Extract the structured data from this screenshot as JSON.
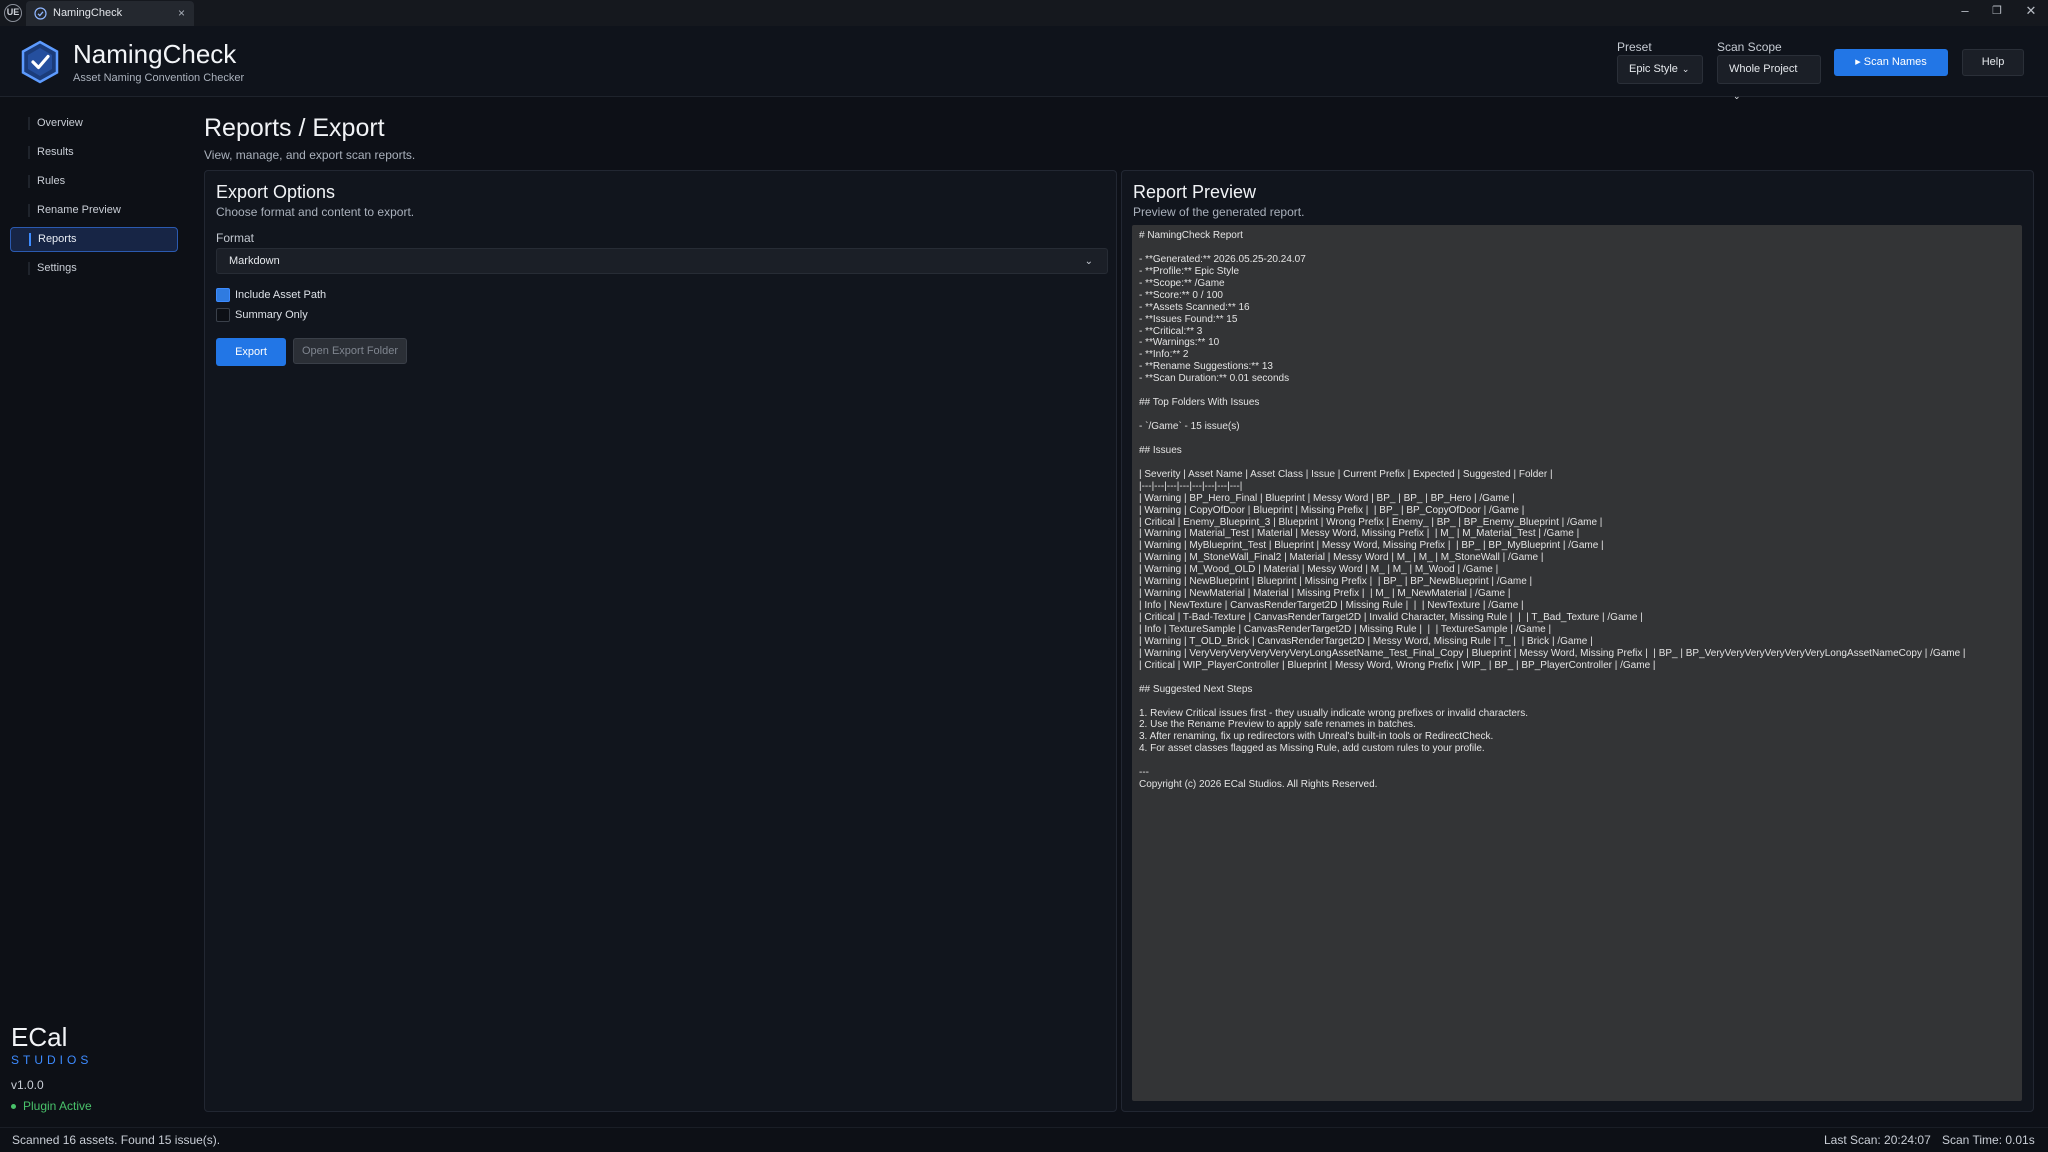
{
  "titlebar": {
    "engine_logo": "UE",
    "tab_label": "NamingCheck",
    "tab_close": "×",
    "minimize": "–",
    "restore": "❐",
    "close": "✕"
  },
  "header": {
    "app_title": "NamingCheck",
    "app_subtitle": "Asset Naming Convention Checker",
    "preset_label": "Preset",
    "preset_value": "Epic Style",
    "scope_label": "Scan Scope",
    "scope_value": "Whole Project",
    "scan_button": "▸ Scan Names",
    "help_button": "Help"
  },
  "sidebar": {
    "items": [
      {
        "label": "Overview",
        "active": false
      },
      {
        "label": "Results",
        "active": false
      },
      {
        "label": "Rules",
        "active": false
      },
      {
        "label": "Rename Preview",
        "active": false
      },
      {
        "label": "Reports",
        "active": true
      },
      {
        "label": "Settings",
        "active": false
      }
    ],
    "brand_name": "ECal",
    "brand_studios": "STUDIOS",
    "version": "v1.0.0",
    "plugin_status": "Plugin Active"
  },
  "page": {
    "title": "Reports / Export",
    "subtitle": "View, manage, and export scan reports."
  },
  "export_options": {
    "title": "Export Options",
    "subtitle": "Choose format and content to export.",
    "format_label": "Format",
    "format_value": "Markdown",
    "include_asset_path_label": "Include Asset Path",
    "include_asset_path_checked": true,
    "summary_only_label": "Summary Only",
    "summary_only_checked": false,
    "export_button": "Export",
    "open_folder_button": "Open Export Folder"
  },
  "report_preview": {
    "title": "Report Preview",
    "subtitle": "Preview of the generated report.",
    "lines": [
      "# NamingCheck Report",
      "",
      "- **Generated:** 2026.05.25-20.24.07",
      "- **Profile:** Epic Style",
      "- **Scope:** /Game",
      "- **Score:** 0 / 100",
      "- **Assets Scanned:** 16",
      "- **Issues Found:** 15",
      "- **Critical:** 3",
      "- **Warnings:** 10",
      "- **Info:** 2",
      "- **Rename Suggestions:** 13",
      "- **Scan Duration:** 0.01 seconds",
      "",
      "## Top Folders With Issues",
      "",
      "- `/Game` - 15 issue(s)",
      "",
      "## Issues",
      "",
      "| Severity | Asset Name | Asset Class | Issue | Current Prefix | Expected | Suggested | Folder |",
      "|---|---|---|---|---|---|---|---|",
      "| Warning | BP_Hero_Final | Blueprint | Messy Word | BP_ | BP_ | BP_Hero | /Game |",
      "| Warning | CopyOfDoor | Blueprint | Missing Prefix |  | BP_ | BP_CopyOfDoor | /Game |",
      "| Critical | Enemy_Blueprint_3 | Blueprint | Wrong Prefix | Enemy_ | BP_ | BP_Enemy_Blueprint | /Game |",
      "| Warning | Material_Test | Material | Messy Word, Missing Prefix |  | M_ | M_Material_Test | /Game |",
      "| Warning | MyBlueprint_Test | Blueprint | Messy Word, Missing Prefix |  | BP_ | BP_MyBlueprint | /Game |",
      "| Warning | M_StoneWall_Final2 | Material | Messy Word | M_ | M_ | M_StoneWall | /Game |",
      "| Warning | M_Wood_OLD | Material | Messy Word | M_ | M_ | M_Wood | /Game |",
      "| Warning | NewBlueprint | Blueprint | Missing Prefix |  | BP_ | BP_NewBlueprint | /Game |",
      "| Warning | NewMaterial | Material | Missing Prefix |  | M_ | M_NewMaterial | /Game |",
      "| Info | NewTexture | CanvasRenderTarget2D | Missing Rule |  |  | NewTexture | /Game |",
      "| Critical | T-Bad-Texture | CanvasRenderTarget2D | Invalid Character, Missing Rule |  |  | T_Bad_Texture | /Game |",
      "| Info | TextureSample | CanvasRenderTarget2D | Missing Rule |  |  | TextureSample | /Game |",
      "| Warning | T_OLD_Brick | CanvasRenderTarget2D | Messy Word, Missing Rule | T_ |  | Brick | /Game |",
      "| Warning | VeryVeryVeryVeryVeryVeryLongAssetName_Test_Final_Copy | Blueprint | Messy Word, Missing Prefix |  | BP_ | BP_VeryVeryVeryVeryVeryVeryLongAssetNameCopy | /Game |",
      "| Critical | WIP_PlayerController | Blueprint | Messy Word, Wrong Prefix | WIP_ | BP_ | BP_PlayerController | /Game |",
      "",
      "## Suggested Next Steps",
      "",
      "1. Review Critical issues first - they usually indicate wrong prefixes or invalid characters.",
      "2. Use the Rename Preview to apply safe renames in batches.",
      "3. After renaming, fix up redirectors with Unreal's built-in tools or RedirectCheck.",
      "4. For asset classes flagged as Missing Rule, add custom rules to your profile.",
      "",
      "---",
      "Copyright (c) 2026 ECal Studios. All Rights Reserved."
    ]
  },
  "statusbar": {
    "left": "Scanned 16 assets. Found 15 issue(s).",
    "last_scan": "Last Scan: 20:24:07",
    "scan_time": "Scan Time: 0.01s"
  },
  "colors": {
    "accent": "#2276e6",
    "active_nav_bg": "#172545",
    "plugin_active": "#49c26a",
    "report_bg": "#333436"
  }
}
